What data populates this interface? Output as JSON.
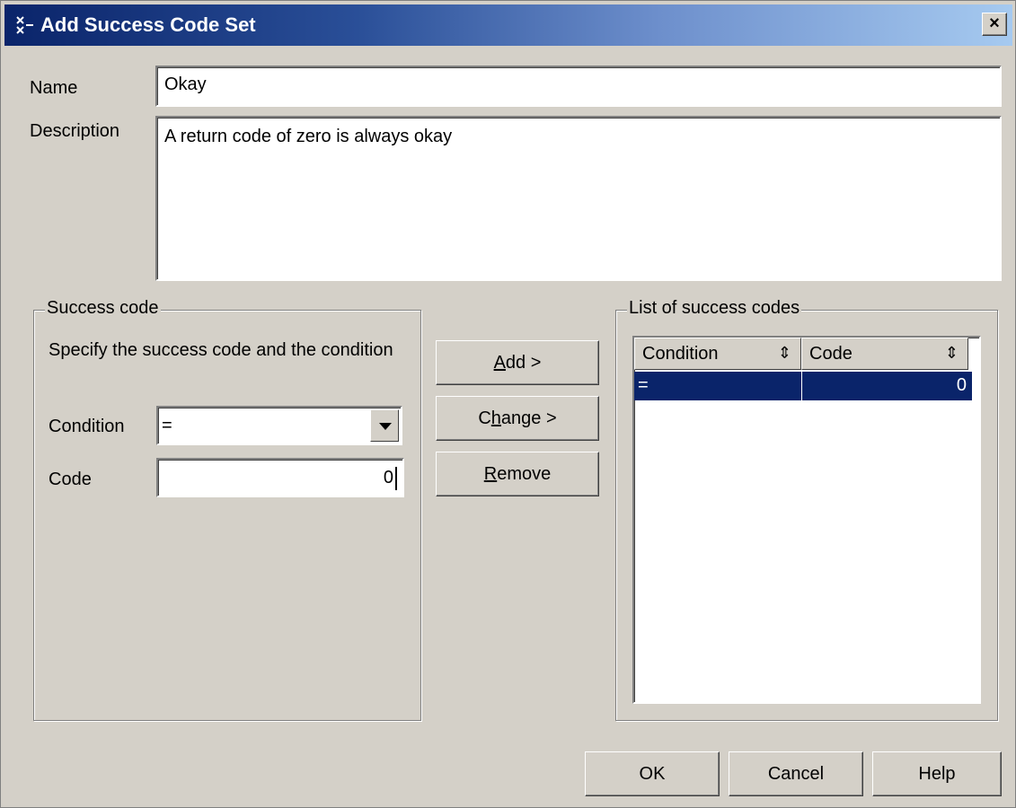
{
  "window": {
    "title": "Add Success Code Set",
    "close_label": "×"
  },
  "name": {
    "label": "Name",
    "value": "Okay"
  },
  "description": {
    "label": "Description",
    "value": "A return code of zero is always okay"
  },
  "success_code": {
    "group_title": "Success code",
    "instructions": "Specify the success code and the condition",
    "condition_label": "Condition",
    "condition_value": "=",
    "code_label": "Code",
    "code_value": "0"
  },
  "actions": {
    "add": {
      "underline": "A",
      "rest": "dd >"
    },
    "change": {
      "before": "C",
      "underline": "h",
      "after": "ange >"
    },
    "remove": {
      "underline": "R",
      "rest": "emove"
    }
  },
  "list": {
    "group_title": "List of success codes",
    "columns": [
      "Condition",
      "Code"
    ],
    "sort_icon": "⇕",
    "rows": [
      {
        "condition": "=",
        "code": "0"
      }
    ]
  },
  "footer": {
    "ok": "OK",
    "cancel": "Cancel",
    "help": "Help"
  }
}
